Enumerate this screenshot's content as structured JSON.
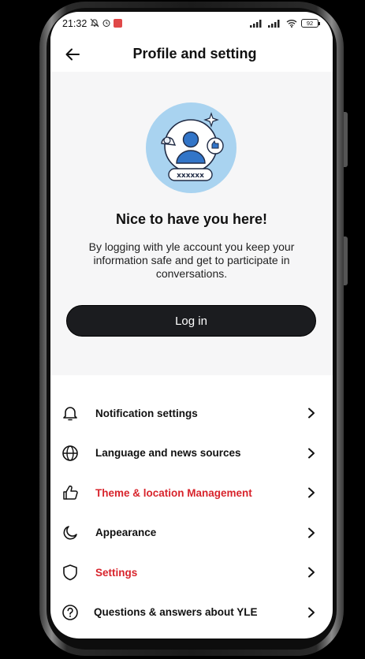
{
  "status_bar": {
    "time": "21:32",
    "battery": "92",
    "icons": [
      "mute-icon",
      "alarm-icon",
      "notification-icon",
      "signal-icon",
      "signal-icon",
      "wifi-icon",
      "battery-icon"
    ]
  },
  "header": {
    "title": "Profile and setting",
    "back_icon": "arrow-left-icon"
  },
  "hero": {
    "title": "Nice to have you here!",
    "description": "By logging with yle account you keep your information safe and get to participate in conversations.",
    "password_mask": "xxxxxx",
    "login_label": "Log in"
  },
  "menu": {
    "items": [
      {
        "label": "Notification settings",
        "icon": "bell-icon",
        "color": "#111111"
      },
      {
        "label": "Language and news sources",
        "icon": "globe-icon",
        "color": "#111111"
      },
      {
        "label": "Theme & location Management",
        "icon": "thumbs-up-icon",
        "color": "#d8242c"
      },
      {
        "label": "Appearance",
        "icon": "moon-icon",
        "color": "#111111"
      },
      {
        "label": "Settings",
        "icon": "shield-icon",
        "color": "#d8242c"
      },
      {
        "label": "Questions & answers about YLE",
        "icon": "question-icon",
        "color": "#111111"
      }
    ]
  },
  "colors": {
    "accent_red": "#d8242c",
    "button_dark": "#1b1c1f",
    "hero_bg": "#f6f6f7",
    "illustration_blue": "#a9d3f0"
  }
}
